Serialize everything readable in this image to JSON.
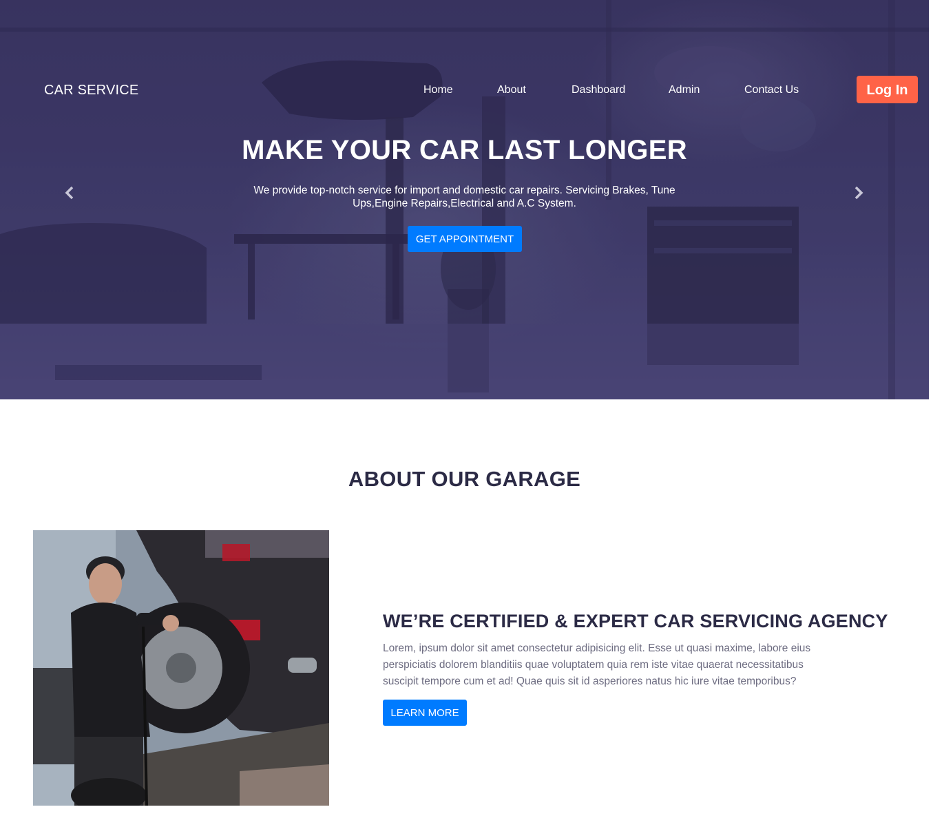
{
  "brand": "CAR SERVICE",
  "nav": [
    {
      "label": "Home"
    },
    {
      "label": "About"
    },
    {
      "label": "Dashboard"
    },
    {
      "label": "Admin"
    },
    {
      "label": "Contact Us"
    }
  ],
  "login_label": "Log In",
  "hero": {
    "title": "MAKE YOUR CAR LAST LONGER",
    "subtitle": "We provide top-notch service for import and domestic car repairs. Servicing Brakes, Tune Ups,Engine Repairs,Electrical and A.C System.",
    "cta_label": "GET APPOINTMENT",
    "prev_icon": "chevron-left-icon",
    "next_icon": "chevron-right-icon"
  },
  "about": {
    "heading": "ABOUT OUR GARAGE",
    "subheading": "WE’RE CERTIFIED & EXPERT CAR SERVICING AGENCY",
    "body": "Lorem, ipsum dolor sit amet consectetur adipisicing elit. Esse ut quasi maxime, labore eius perspiciatis dolorem blanditiis quae voluptatem quia rem iste vitae quaerat necessitatibus suscipit tempore cum et ad! Quae quis sit id asperiores natus hic iure vitae temporibus?",
    "cta_label": "LEARN MORE"
  },
  "colors": {
    "login_button": "#ff6347",
    "primary_button": "#007bff",
    "hero_overlay": "#3d3966",
    "heading_text": "#2b2a45",
    "body_text": "#6c6b80"
  }
}
